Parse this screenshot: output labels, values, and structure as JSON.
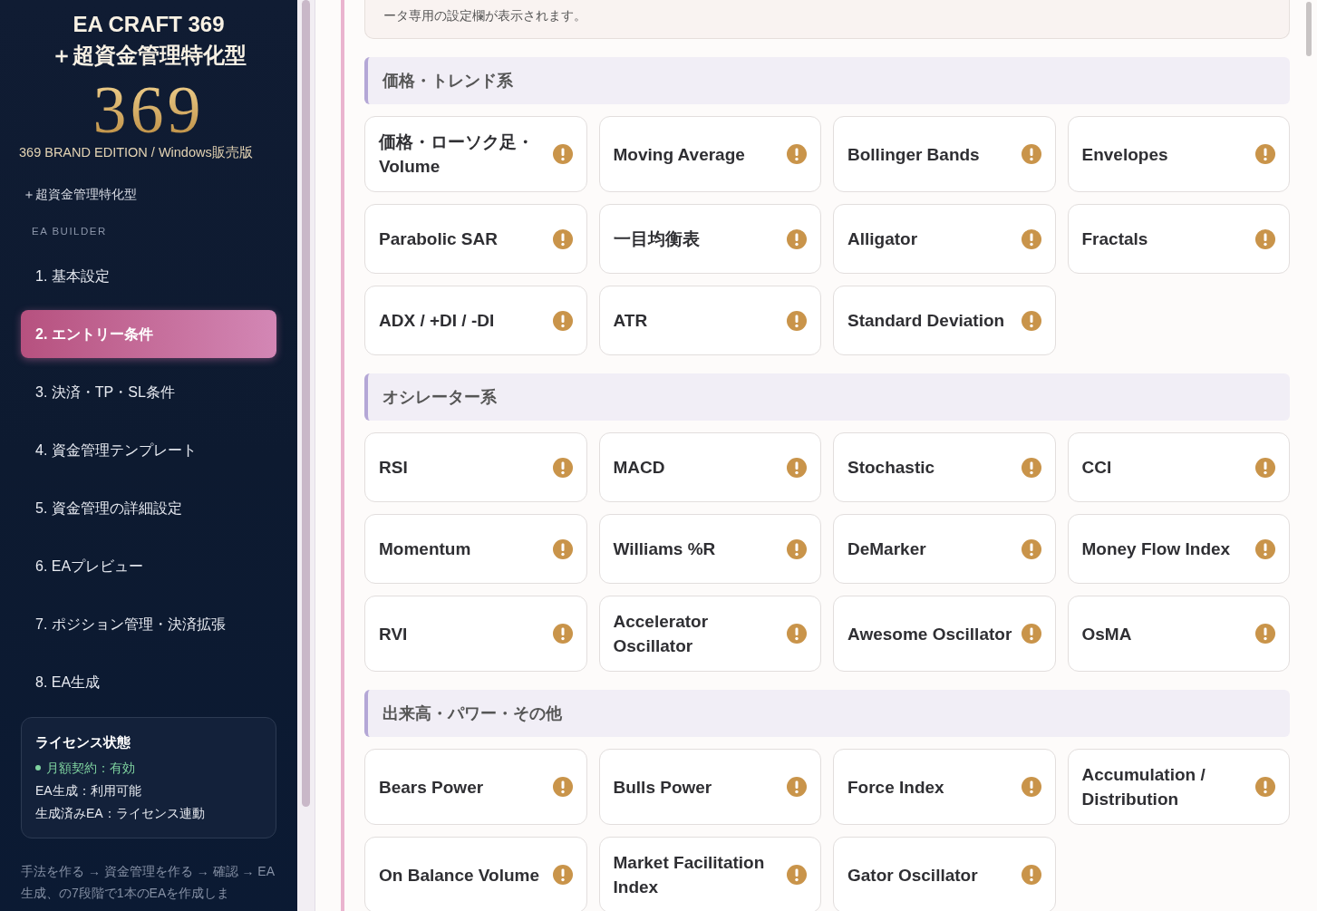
{
  "sidebar": {
    "title": "EA CRAFT 369",
    "subtitle": "＋超資金管理特化型",
    "logo": "369",
    "edition": "369 BRAND EDITION / Windows販売版",
    "tagline": "＋超資金管理特化型",
    "section_label": "EA BUILDER",
    "nav": [
      {
        "label": "1. 基本設定",
        "selected": false
      },
      {
        "label": "2. エントリー条件",
        "selected": true
      },
      {
        "label": "3. 決済・TP・SL条件",
        "selected": false
      },
      {
        "label": "4. 資金管理テンプレート",
        "selected": false
      },
      {
        "label": "5. 資金管理の詳細設定",
        "selected": false
      },
      {
        "label": "6. EAプレビュー",
        "selected": false
      },
      {
        "label": "7. ポジション管理・決済拡張",
        "selected": false
      },
      {
        "label": "8. EA生成",
        "selected": false
      }
    ],
    "license": {
      "title": "ライセンス状態",
      "status": "月額契約：有効",
      "lines": [
        "EA生成：利用可能",
        "生成済みEA：ライセンス連動"
      ]
    },
    "footer": "手法を作る → 資金管理を作る → 確認 → EA生成、の7段階で1本のEAを作成しま"
  },
  "main": {
    "intro": "ータ専用の設定欄が表示されます。",
    "sections": [
      {
        "title": "価格・トレンド系",
        "indicators": [
          {
            "name": "価格・ローソク足・Volume"
          },
          {
            "name": "Moving Average"
          },
          {
            "name": "Bollinger Bands"
          },
          {
            "name": "Envelopes"
          },
          {
            "name": "Parabolic SAR"
          },
          {
            "name": "一目均衡表"
          },
          {
            "name": "Alligator"
          },
          {
            "name": "Fractals"
          },
          {
            "name": "ADX / +DI / -DI"
          },
          {
            "name": "ATR"
          },
          {
            "name": "Standard Deviation"
          }
        ]
      },
      {
        "title": "オシレーター系",
        "indicators": [
          {
            "name": "RSI"
          },
          {
            "name": "MACD"
          },
          {
            "name": "Stochastic"
          },
          {
            "name": "CCI"
          },
          {
            "name": "Momentum"
          },
          {
            "name": "Williams %R"
          },
          {
            "name": "DeMarker"
          },
          {
            "name": "Money Flow Index"
          },
          {
            "name": "RVI"
          },
          {
            "name": "Accelerator Oscillator"
          },
          {
            "name": "Awesome Oscillator"
          },
          {
            "name": "OsMA"
          }
        ]
      },
      {
        "title": "出来高・パワー・その他",
        "indicators": [
          {
            "name": "Bears Power"
          },
          {
            "name": "Bulls Power"
          },
          {
            "name": "Force Index"
          },
          {
            "name": "Accumulation / Distribution"
          },
          {
            "name": "On Balance Volume"
          },
          {
            "name": "Market Facilitation Index"
          },
          {
            "name": "Gator Oscillator"
          }
        ]
      }
    ]
  }
}
